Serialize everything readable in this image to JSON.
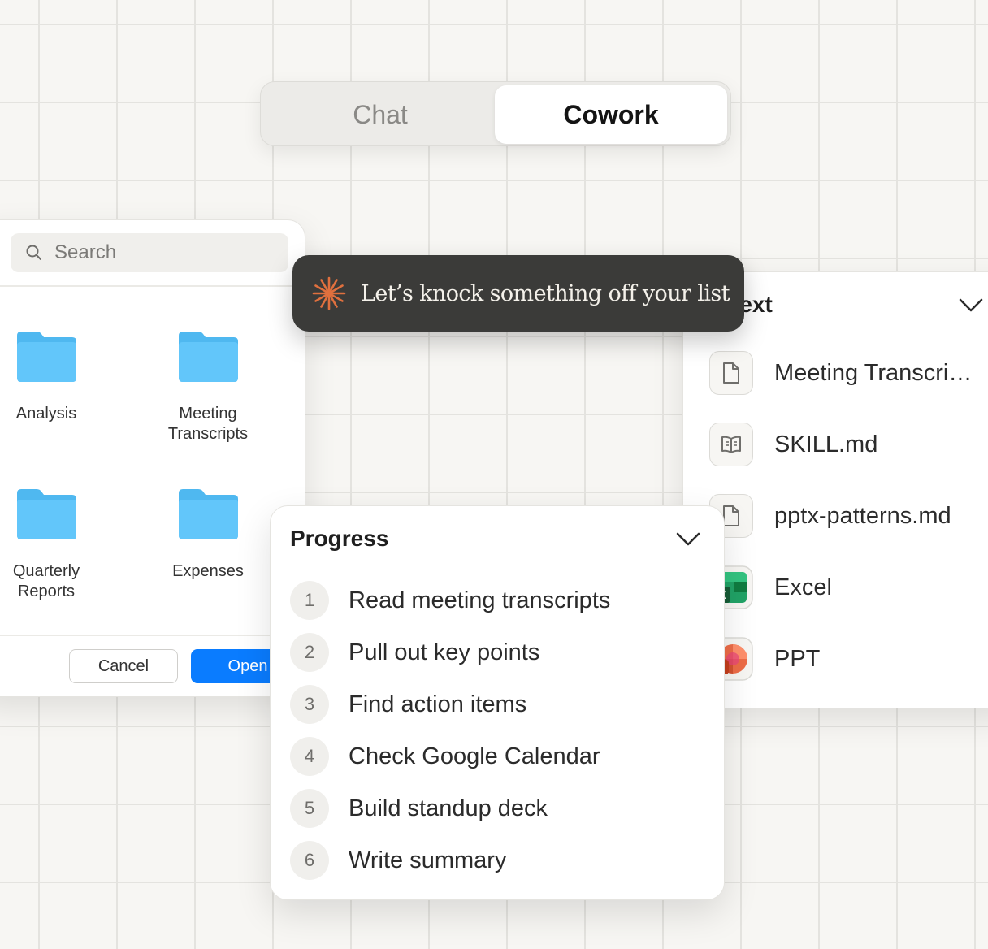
{
  "mode_toggle": {
    "tabs": [
      {
        "label": "Chat",
        "active": false
      },
      {
        "label": "Cowork",
        "active": true
      }
    ]
  },
  "file_picker": {
    "search_placeholder": "Search",
    "folders": [
      {
        "label": "Analysis",
        "icon": "folder-icon"
      },
      {
        "label": "Meeting\nTranscripts",
        "icon": "folder-icon"
      },
      {
        "label": "Quarterly\nReports",
        "icon": "folder-icon"
      },
      {
        "label": "Expenses",
        "icon": "folder-icon"
      }
    ],
    "cancel_label": "Cancel",
    "open_label": "Open",
    "folder_color": "#5ac8fa",
    "open_color": "#0a7cff"
  },
  "tooltip": {
    "text": "Let’s knock something off your list",
    "icon": "sparkle-burst-icon",
    "icon_color": "#e0703e"
  },
  "context_panel": {
    "title": "text",
    "items": [
      {
        "label": "Meeting Transcripts",
        "icon": "document-icon"
      },
      {
        "label": "SKILL.md",
        "icon": "book-icon"
      },
      {
        "label": "pptx-patterns.md",
        "icon": "document-icon"
      },
      {
        "label": "Excel",
        "icon": "excel-icon"
      },
      {
        "label": "PPT",
        "icon": "powerpoint-icon"
      }
    ]
  },
  "progress_panel": {
    "title": "Progress",
    "steps": [
      {
        "number": "1",
        "label": "Read meeting transcripts"
      },
      {
        "number": "2",
        "label": "Pull out key points"
      },
      {
        "number": "3",
        "label": "Find action items"
      },
      {
        "number": "4",
        "label": "Check Google Calendar"
      },
      {
        "number": "5",
        "label": "Build standup deck"
      },
      {
        "number": "6",
        "label": "Write summary"
      }
    ]
  }
}
